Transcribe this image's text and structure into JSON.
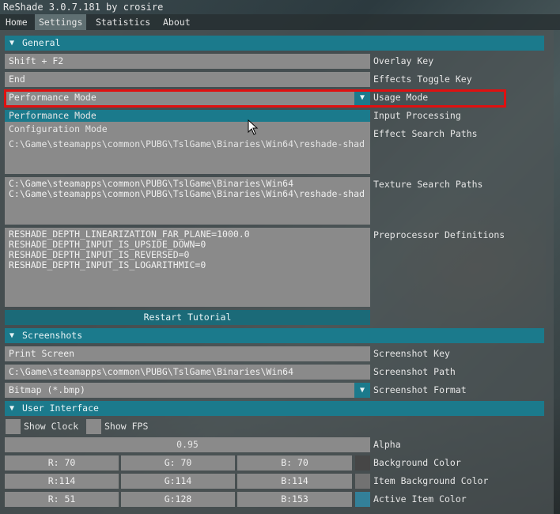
{
  "window": {
    "title": "ReShade 3.0.7.181 by crosire"
  },
  "menu": [
    {
      "label": "Home",
      "active": false
    },
    {
      "label": "Settings",
      "active": true
    },
    {
      "label": "Statistics",
      "active": false
    },
    {
      "label": "About",
      "active": false
    }
  ],
  "general": {
    "header": "General",
    "overlay_key": {
      "value": "Shift + F2",
      "label": "Overlay Key"
    },
    "effects_toggle_key": {
      "value": "End",
      "label": "Effects Toggle Key"
    },
    "usage_mode": {
      "value": "Performance Mode",
      "label": "Usage Mode"
    },
    "usage_mode_options": [
      "Performance Mode",
      "Configuration Mode"
    ],
    "input_processing_label": "Input Processing",
    "effect_search_paths": {
      "value": "C:\\Game\\steamapps\\common\\PUBG\\TslGame\\Binaries\\Win64\\reshade-shad",
      "label": "Effect Search Paths"
    },
    "texture_search_paths": {
      "lines": [
        "C:\\Game\\steamapps\\common\\PUBG\\TslGame\\Binaries\\Win64",
        "C:\\Game\\steamapps\\common\\PUBG\\TslGame\\Binaries\\Win64\\reshade-shad"
      ],
      "label": "Texture Search Paths"
    },
    "preprocessor_definitions": {
      "lines": [
        "RESHADE_DEPTH_LINEARIZATION_FAR_PLANE=1000.0",
        "RESHADE_DEPTH_INPUT_IS_UPSIDE_DOWN=0",
        "RESHADE_DEPTH_INPUT_IS_REVERSED=0",
        "RESHADE_DEPTH_INPUT_IS_LOGARITHMIC=0"
      ],
      "label": "Preprocessor Definitions"
    },
    "restart_tutorial": "Restart Tutorial"
  },
  "screenshots": {
    "header": "Screenshots",
    "key": {
      "value": "Print Screen",
      "label": "Screenshot Key"
    },
    "path": {
      "value": "C:\\Game\\steamapps\\common\\PUBG\\TslGame\\Binaries\\Win64",
      "label": "Screenshot Path"
    },
    "format": {
      "value": "Bitmap (*.bmp)",
      "label": "Screenshot Format"
    }
  },
  "ui": {
    "header": "User Interface",
    "show_clock": "Show Clock",
    "show_fps": "Show FPS",
    "alpha": {
      "value": "0.95",
      "label": "Alpha"
    },
    "background_color": {
      "r": "R: 70",
      "g": "G: 70",
      "b": "B: 70",
      "label": "Background Color",
      "swatch": "#464646"
    },
    "item_background_color": {
      "r": "R:114",
      "g": "G:114",
      "b": "B:114",
      "label": "Item Background Color",
      "swatch": "#727272"
    },
    "active_item_color": {
      "r": "R: 51",
      "g": "G:128",
      "b": "B:153",
      "label": "Active Item Color",
      "swatch": "#338099"
    }
  },
  "colors": {
    "accent": "#1b7a8c",
    "highlight": "#e01010"
  }
}
